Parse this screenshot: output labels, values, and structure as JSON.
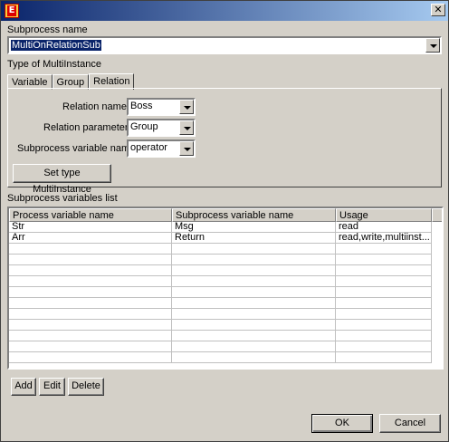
{
  "window": {
    "close_glyph": "✕",
    "app_icon_glyph": "E"
  },
  "subprocess": {
    "label": "Subprocess name",
    "value": "MultiOnRelationSub"
  },
  "multiinstance": {
    "group_label": "Type of MultiInstance",
    "tabs": [
      {
        "label": "Variable"
      },
      {
        "label": "Group"
      },
      {
        "label": "Relation",
        "active": true
      }
    ],
    "relation_name_label": "Relation name:",
    "relation_name_value": "Boss",
    "relation_parameter_label": "Relation parameter:",
    "relation_parameter_value": "Group",
    "subprocess_variable_label": "Subprocess variable name:",
    "subprocess_variable_value": "operator",
    "set_type_button": "Set type MultiInstance"
  },
  "variables": {
    "label": "Subprocess variables list",
    "columns": [
      "Process variable name",
      "Subprocess variable name",
      "Usage"
    ],
    "rows": [
      [
        "Str",
        "Msg",
        "read"
      ],
      [
        "Arr",
        "Return",
        "read,write,multiinst..."
      ],
      [
        "",
        "",
        ""
      ],
      [
        "",
        "",
        ""
      ],
      [
        "",
        "",
        ""
      ],
      [
        "",
        "",
        ""
      ],
      [
        "",
        "",
        ""
      ],
      [
        "",
        "",
        ""
      ],
      [
        "",
        "",
        ""
      ],
      [
        "",
        "",
        ""
      ],
      [
        "",
        "",
        ""
      ],
      [
        "",
        "",
        ""
      ],
      [
        "",
        "",
        ""
      ]
    ]
  },
  "buttons": {
    "add": "Add",
    "edit": "Edit",
    "delete": "Delete",
    "ok": "OK",
    "cancel": "Cancel"
  },
  "colors": {
    "titlebar_start": "#0a246a",
    "titlebar_end": "#a6caf0",
    "dialog_bg": "#d4d0c8",
    "selection": "#0a246a"
  }
}
